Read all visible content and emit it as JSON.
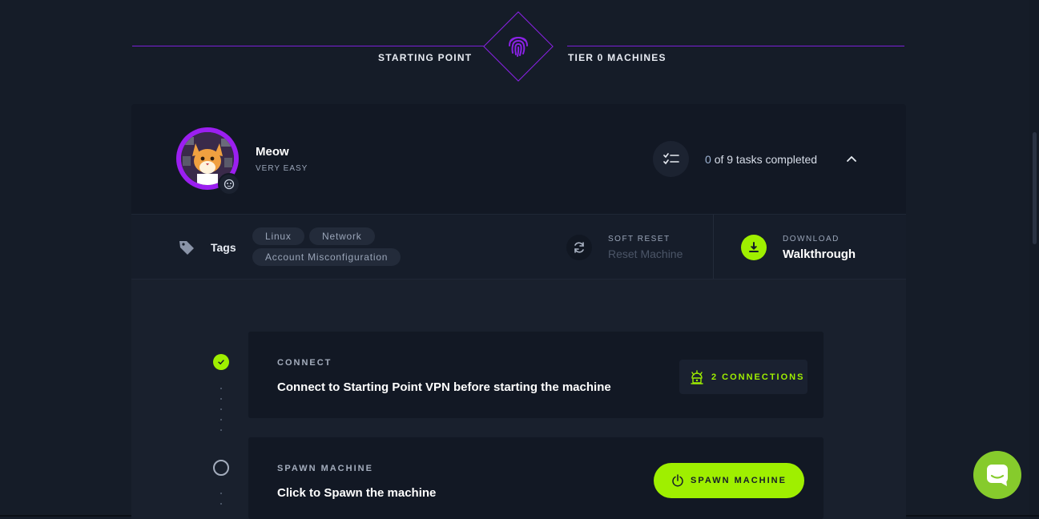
{
  "header": {
    "left_label": "STARTING POINT",
    "right_label": "TIER 0 MACHINES",
    "emblem_icon": "fingerprint-icon",
    "accent_color": "#8a22e6"
  },
  "machine": {
    "name": "Meow",
    "difficulty": "VERY EASY",
    "avatar_icon": "cat-avatar",
    "os_icon": "linux-icon",
    "tasks_completed": "0",
    "tasks_rest": "of 9 tasks completed",
    "collapse_icon": "chevron-up-icon"
  },
  "tags": {
    "label": "Tags",
    "items": [
      "Linux",
      "Network",
      "Account Misconfiguration"
    ]
  },
  "reset": {
    "small_label": "SOFT RESET",
    "label": "Reset Machine"
  },
  "download": {
    "small_label": "DOWNLOAD",
    "label": "Walkthrough"
  },
  "steps": [
    {
      "title": "CONNECT",
      "description": "Connect to Starting Point VPN before starting the machine",
      "status": "done",
      "action_label": "2 CONNECTIONS"
    },
    {
      "title": "SPAWN MACHINE",
      "description": "Click to Spawn the machine",
      "status": "pending",
      "action_label": "SPAWN MACHINE"
    }
  ],
  "colors": {
    "primary_green": "#9fef00",
    "background": "#151c28",
    "card": "#121824",
    "chat": "#86cb2c"
  }
}
